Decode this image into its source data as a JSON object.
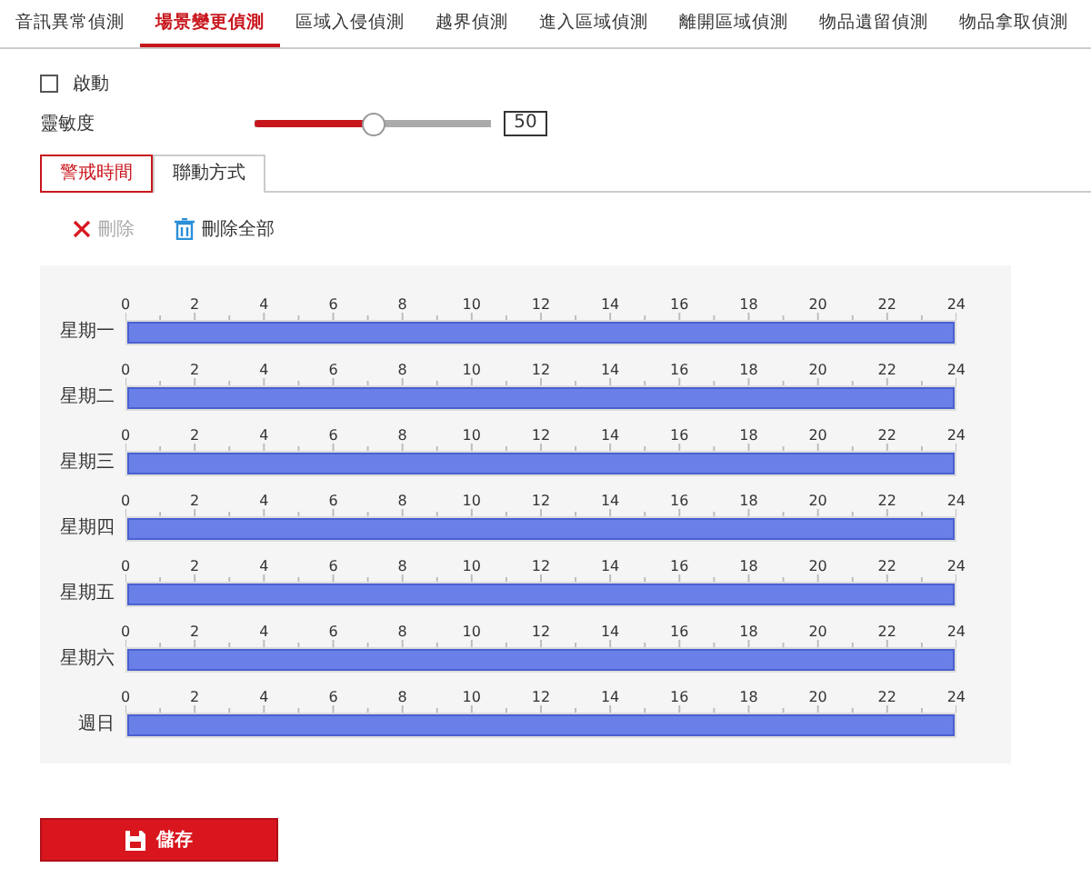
{
  "tabs": [
    {
      "label": "音訊異常偵測",
      "selected": false
    },
    {
      "label": "場景變更偵測",
      "selected": true
    },
    {
      "label": "區域入侵偵測",
      "selected": false
    },
    {
      "label": "越界偵測",
      "selected": false
    },
    {
      "label": "進入區域偵測",
      "selected": false
    },
    {
      "label": "離開區域偵測",
      "selected": false
    },
    {
      "label": "物品遺留偵測",
      "selected": false
    },
    {
      "label": "物品拿取偵測",
      "selected": false
    }
  ],
  "enable": {
    "label": "啟動",
    "checked": false
  },
  "sensitivity": {
    "label": "靈敏度",
    "level": 0.5,
    "value": "50"
  },
  "sub_tabs": [
    {
      "label": "警戒時間",
      "selected": true
    },
    {
      "label": "聯動方式",
      "selected": false
    }
  ],
  "toolbar": [
    {
      "kind": "delete",
      "label": "刪除",
      "disabled": true
    },
    {
      "kind": "delete_all",
      "label": "刪除全部",
      "disabled": false
    }
  ],
  "schedule": [
    {
      "day": "星期一",
      "level": 1,
      "ticks": [
        "0",
        "2",
        "4",
        "6",
        "8",
        "10",
        "12",
        "14",
        "16",
        "18",
        "20",
        "22",
        "24"
      ]
    },
    {
      "day": "星期二",
      "level": 1,
      "ticks": [
        "0",
        "2",
        "4",
        "6",
        "8",
        "10",
        "12",
        "14",
        "16",
        "18",
        "20",
        "22",
        "24"
      ]
    },
    {
      "day": "星期三",
      "level": 1,
      "ticks": [
        "0",
        "2",
        "4",
        "6",
        "8",
        "10",
        "12",
        "14",
        "16",
        "18",
        "20",
        "22",
        "24"
      ]
    },
    {
      "day": "星期四",
      "level": 1,
      "ticks": [
        "0",
        "2",
        "4",
        "6",
        "8",
        "10",
        "12",
        "14",
        "16",
        "18",
        "20",
        "22",
        "24"
      ]
    },
    {
      "day": "星期五",
      "level": 1,
      "ticks": [
        "0",
        "2",
        "4",
        "6",
        "8",
        "10",
        "12",
        "14",
        "16",
        "18",
        "20",
        "22",
        "24"
      ]
    },
    {
      "day": "星期六",
      "level": 1,
      "ticks": [
        "0",
        "2",
        "4",
        "6",
        "8",
        "10",
        "12",
        "14",
        "16",
        "18",
        "20",
        "22",
        "24"
      ]
    },
    {
      "day": "週日",
      "level": 1,
      "ticks": [
        "0",
        "2",
        "4",
        "6",
        "8",
        "10",
        "12",
        "14",
        "16",
        "18",
        "20",
        "22",
        "24"
      ]
    }
  ],
  "save_button": {
    "label": "儲存"
  }
}
